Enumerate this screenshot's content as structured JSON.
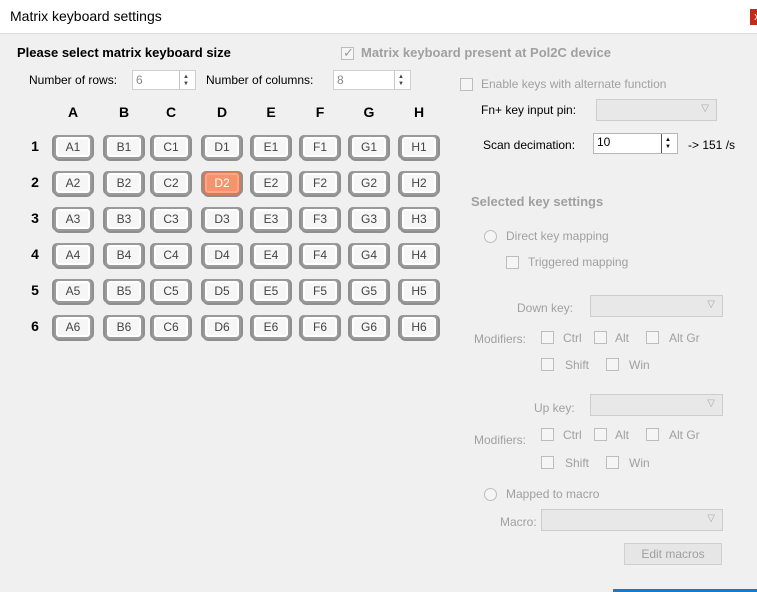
{
  "window": {
    "title": "Matrix keyboard settings",
    "close_glyph": "x"
  },
  "size_section": {
    "heading": "Please select matrix keyboard size",
    "rows_label": "Number of rows:",
    "rows_value": "6",
    "cols_label": "Number of columns:",
    "cols_value": "8"
  },
  "matrix": {
    "columns": [
      "A",
      "B",
      "C",
      "D",
      "E",
      "F",
      "G",
      "H"
    ],
    "rows": [
      "1",
      "2",
      "3",
      "4",
      "5",
      "6"
    ],
    "selected_key": "D2",
    "selected_color": "#f5946c"
  },
  "right_panel": {
    "present_label": "Matrix keyboard present at Pol2C device",
    "present_checked": true,
    "alternate_label": "Enable keys with alternate function",
    "fn_pin_label": "Fn+ key input pin:",
    "scan_label": "Scan decimation:",
    "scan_value": "10",
    "scan_rate": "-> 151 /s"
  },
  "key_settings": {
    "heading": "Selected key settings",
    "direct_label": "Direct key mapping",
    "triggered_label": "Triggered mapping",
    "down_key_label": "Down key:",
    "modifiers_label": "Modifiers:",
    "ctrl": "Ctrl",
    "alt": "Alt",
    "altgr": "Alt Gr",
    "shift": "Shift",
    "win": "Win",
    "up_key_label": "Up key:",
    "macro_radio_label": "Mapped to macro",
    "macro_label": "Macro:",
    "edit_macros": "Edit macros"
  }
}
